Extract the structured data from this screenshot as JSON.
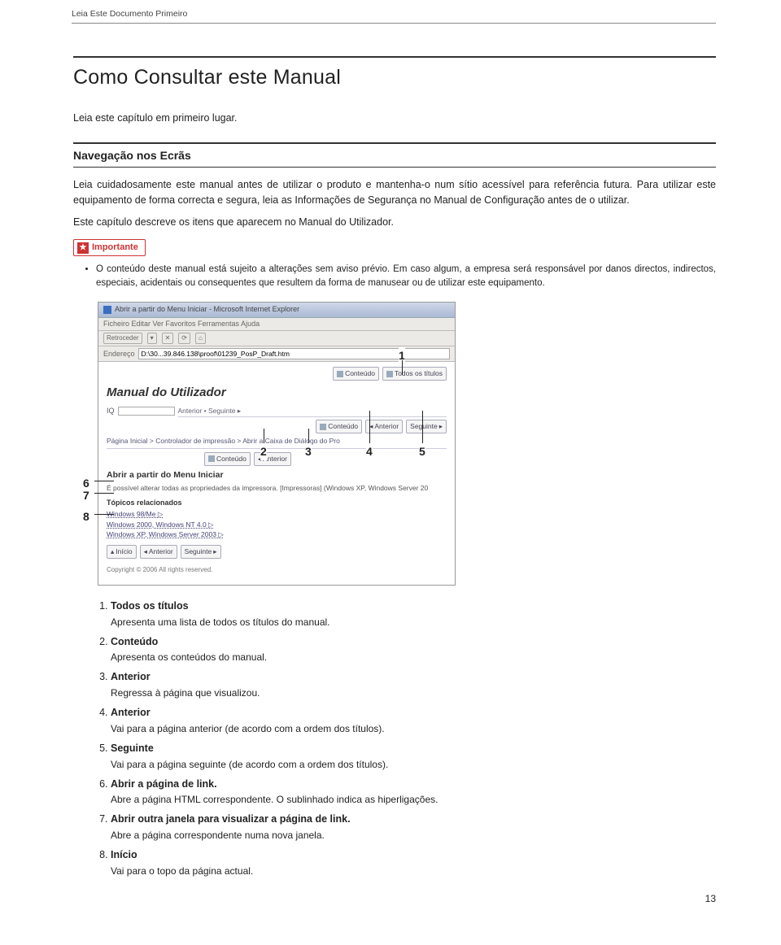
{
  "runningHeader": "Leia Este Documento Primeiro",
  "title": "Como Consultar este Manual",
  "intro": "Leia este capítulo em primeiro lugar.",
  "sectionHeading": "Navegação nos Ecrãs",
  "para1": "Leia cuidadosamente este manual antes de utilizar o produto e mantenha-o num sítio acessível para referência futura. Para utilizar este equipamento de forma correcta e segura, leia as Informações de Segurança no Manual de Configuração antes de o utilizar.",
  "para2": "Este capítulo descreve os itens que aparecem no Manual do Utilizador.",
  "importanteLabel": "Importante",
  "bullet1": "O conteúdo deste manual está sujeito a alterações sem aviso prévio. Em caso algum, a empresa será responsável por danos directos, indirectos, especiais, acidentais ou consequentes que resultem da forma de manusear ou de utilizar este equipamento.",
  "figure": {
    "windowTitle": "Abrir a partir do Menu Iniciar - Microsoft Internet Explorer",
    "menubar": "Ficheiro   Editar   Ver   Favoritos   Ferramentas   Ajuda",
    "backLabel": "Retroceder",
    "addressLabel": "Endereço",
    "addressValue": "D:\\30...39.846.138\\proof\\01239_PosP_Draft.htm",
    "manualTitle": "Manual do Utilizador",
    "btnConteudo": "Conteúdo",
    "btnTodosTitulos": "Todos os títulos",
    "btnAnterior": "Anterior",
    "btnSeguinte": "Seguinte",
    "breadcrumb": "Página Inicial > Controlador de impressão > Abrir a Caixa de Diálogo do Pro",
    "crumbExcerpt": "Anterior • Seguinte ▸",
    "innerTitle": "Abrir a partir do Menu Iniciar",
    "innerText": "É possível alterar todas as propriedades da impressora. [Impressoras] (Windows XP, Windows Server 20",
    "topicsTitle": "Tópicos relacionados",
    "links": [
      "Windows 98/Me ▷",
      "Windows 2000, Windows NT 4.0 ▷",
      "Windows XP, Windows Server 2003 ▷"
    ],
    "bottomBtns": [
      "Início",
      "Anterior",
      "Seguinte"
    ],
    "copyright": "Copyright © 2006 All rights reserved."
  },
  "callouts": [
    "1",
    "2",
    "3",
    "4",
    "5",
    "6",
    "7",
    "8"
  ],
  "defs": [
    {
      "term": "Todos os títulos",
      "desc": "Apresenta uma lista de todos os títulos do manual."
    },
    {
      "term": "Conteúdo",
      "desc": "Apresenta os conteúdos do manual."
    },
    {
      "term": "Anterior",
      "desc": "Regressa à página que visualizou."
    },
    {
      "term": "Anterior",
      "desc": "Vai para a página anterior (de acordo com a ordem dos títulos)."
    },
    {
      "term": "Seguinte",
      "desc": "Vai para a página seguinte (de acordo com a ordem dos títulos)."
    },
    {
      "term": "Abrir a página de link.",
      "desc": "Abre a página HTML correspondente. O sublinhado indica as hiperligações."
    },
    {
      "term": "Abrir outra janela para visualizar a página de link.",
      "desc": "Abre a página correspondente numa nova janela."
    },
    {
      "term": "Início",
      "desc": "Vai para o topo da página actual."
    }
  ],
  "pageNumber": "13"
}
